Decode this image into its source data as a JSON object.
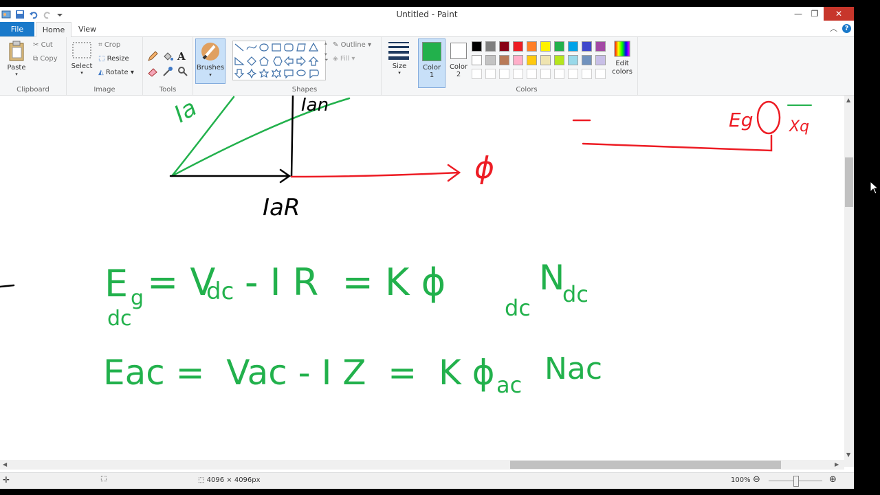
{
  "window": {
    "title": "Untitled - Paint"
  },
  "tabs": {
    "file": "File",
    "home": "Home",
    "view": "View"
  },
  "clipboard": {
    "paste": "Paste",
    "cut": "Cut",
    "copy": "Copy",
    "label": "Clipboard"
  },
  "image": {
    "select": "Select",
    "crop": "Crop",
    "resize": "Resize",
    "rotate": "Rotate",
    "label": "Image"
  },
  "tools": {
    "label": "Tools"
  },
  "brushes": {
    "label": "Brushes"
  },
  "shapes": {
    "outline": "Outline",
    "fill": "Fill",
    "label": "Shapes"
  },
  "size": {
    "label": "Size"
  },
  "colors": {
    "color1_label": "Color",
    "color1_num": "1",
    "color2_label": "Color",
    "color2_num": "2",
    "edit_label_1": "Edit",
    "edit_label_2": "colors",
    "label": "Colors",
    "color1_value": "#22b14c",
    "color2_value": "#ffffff",
    "palette_row1": [
      "#000000",
      "#7f7f7f",
      "#880015",
      "#ed1c24",
      "#ff7f27",
      "#fff200",
      "#22b14c",
      "#00a2e8",
      "#3f48cc",
      "#a349a4"
    ],
    "palette_row2": [
      "#ffffff",
      "#c3c3c3",
      "#b97a57",
      "#ffaec9",
      "#ffc90e",
      "#efe4b0",
      "#b5e61d",
      "#99d9ea",
      "#7092be",
      "#c8bfe7"
    ]
  },
  "status": {
    "dimensions": "4096 × 4096px",
    "zoom": "100%"
  },
  "drawing": {
    "label_ia_top": "Ia",
    "label_ian": "Ian",
    "label_iar": "IaR",
    "label_phi": "ϕ",
    "label_eg": "Eg",
    "label_xq": "Xq",
    "eq1_lhs": "E",
    "eq1_lhs_sub": "g",
    "eq1_dc": "dc",
    "eq1_rest": "= V",
    "eq1_vdc_sub": "dc",
    "eq1_mid": "- I R  = K ϕ",
    "eq1_phi_sub": "dc",
    "eq1_n": "N",
    "eq1_n_sub": "dc",
    "eq2_lhs": "Eac =  Vac - I Z  =  K ϕ",
    "eq2_phi_sub": "ac",
    "eq2_rhs": "Nac"
  }
}
